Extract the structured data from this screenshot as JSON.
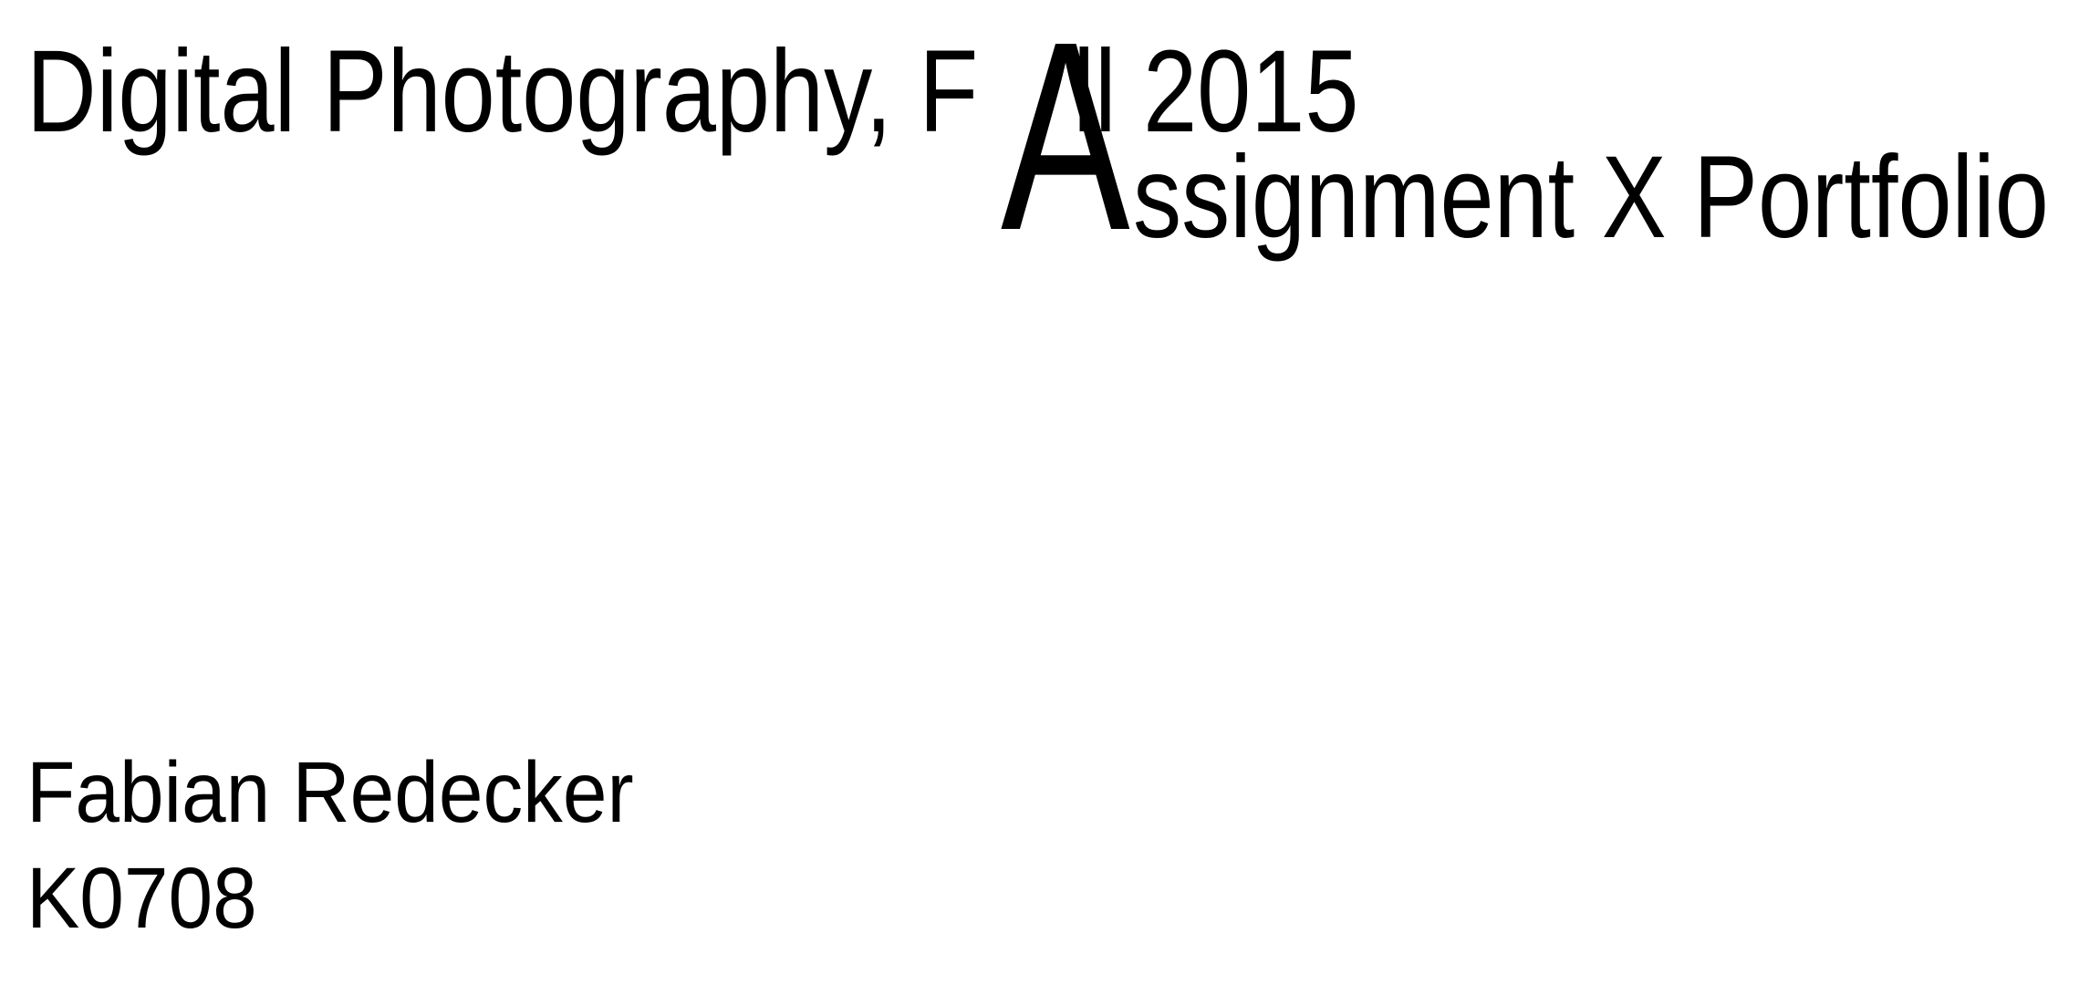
{
  "title": {
    "line1_before": "Digital Photography, F",
    "big_letter": "A",
    "line1_after": "ll 2015",
    "line2_rest": "ssignment X Portfolio"
  },
  "author": {
    "name": "Fabian Redecker",
    "id": "K0708"
  }
}
